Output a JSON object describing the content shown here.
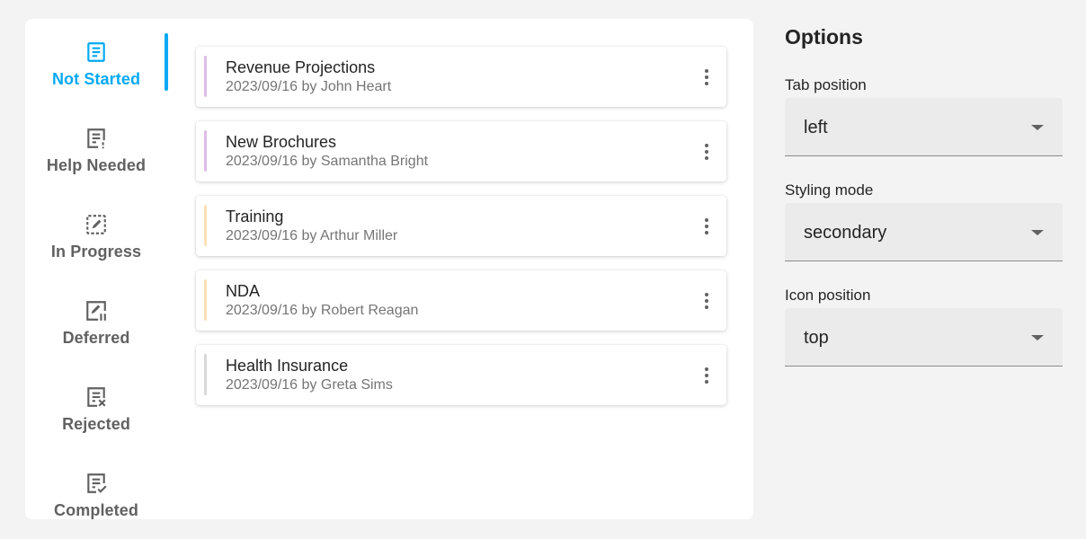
{
  "tabs": [
    {
      "label": "Not Started",
      "icon": "notes-icon",
      "selected": true
    },
    {
      "label": "Help Needed",
      "icon": "help-notes-icon",
      "selected": false
    },
    {
      "label": "In Progress",
      "icon": "edit-dashed-icon",
      "selected": false
    },
    {
      "label": "Deferred",
      "icon": "edit-pause-icon",
      "selected": false
    },
    {
      "label": "Rejected",
      "icon": "notes-x-icon",
      "selected": false
    },
    {
      "label": "Completed",
      "icon": "notes-check-icon",
      "selected": false
    }
  ],
  "tasks": [
    {
      "title": "Revenue Projections",
      "meta": "2023/09/16 by John Heart",
      "priority_color": "#dfbde8"
    },
    {
      "title": "New Brochures",
      "meta": "2023/09/16 by Samantha Bright",
      "priority_color": "#dfbde8"
    },
    {
      "title": "Training",
      "meta": "2023/09/16 by Arthur Miller",
      "priority_color": "#fbe2b6"
    },
    {
      "title": "NDA",
      "meta": "2023/09/16 by Robert Reagan",
      "priority_color": "#fbe2b6"
    },
    {
      "title": "Health Insurance",
      "meta": "2023/09/16 by Greta Sims",
      "priority_color": "#d8d8d8"
    }
  ],
  "options": {
    "title": "Options",
    "tab_position": {
      "label": "Tab position",
      "value": "left"
    },
    "styling_mode": {
      "label": "Styling mode",
      "value": "secondary"
    },
    "icon_position": {
      "label": "Icon position",
      "value": "top"
    }
  },
  "colors": {
    "accent": "#03a9f4",
    "tab_inactive": "#616161",
    "background": "#f3f3f3"
  }
}
